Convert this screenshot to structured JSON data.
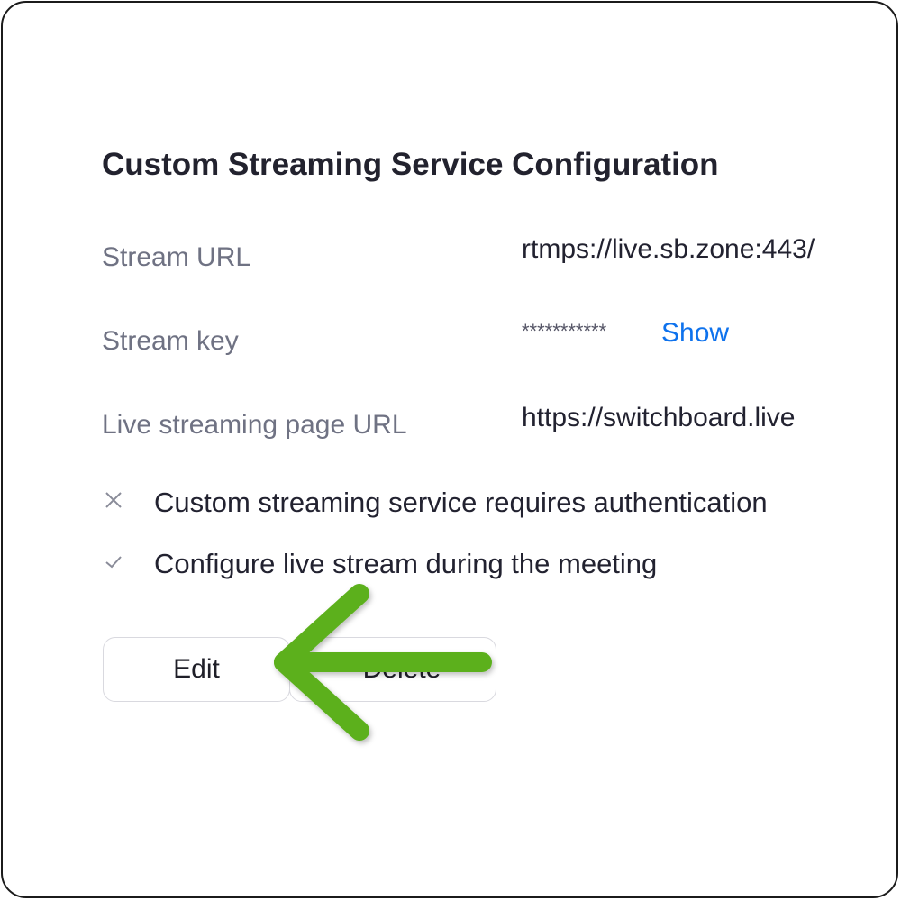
{
  "title": "Custom Streaming Service Configuration",
  "fields": [
    {
      "label": "Stream URL",
      "value": "rtmps://live.sb.zone:443/"
    },
    {
      "label": "Stream key",
      "value": "***********",
      "action": "Show"
    },
    {
      "label": "Live streaming page URL",
      "value": "https://switchboard.live"
    }
  ],
  "options": [
    {
      "icon": "x-icon",
      "text": "Custom streaming service requires authentication"
    },
    {
      "icon": "check-icon",
      "text": "Configure live stream during the meeting"
    }
  ],
  "buttons": {
    "edit": "Edit",
    "delete": "Delete"
  },
  "colors": {
    "link": "#0e72ed",
    "arrow": "#5cb01f",
    "title": "#22222e",
    "label": "#6f7283"
  },
  "annotation": {
    "icon": "arrow-left-icon"
  }
}
